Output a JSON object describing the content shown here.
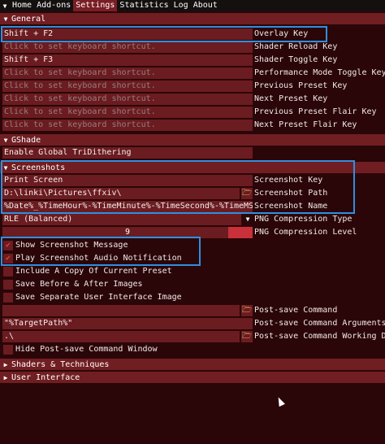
{
  "menubar": {
    "items": [
      "Home",
      "Add-ons",
      "Settings",
      "Statistics",
      "Log",
      "About"
    ],
    "active": "Settings"
  },
  "sections": {
    "general": "General",
    "gshade": "GShade",
    "screenshots": "Screenshots",
    "shaders": "Shaders & Techniques",
    "ui": "User Interface"
  },
  "general": {
    "rows": [
      {
        "value": "Shift + F2",
        "label": "Overlay Key"
      },
      {
        "value": "Click to set keyboard shortcut.",
        "label": "Shader Reload Key"
      },
      {
        "value": "Shift + F3",
        "label": "Shader Toggle Key"
      },
      {
        "value": "Click to set keyboard shortcut.",
        "label": "Performance Mode Toggle Key"
      },
      {
        "value": "Click to set keyboard shortcut.",
        "label": "Previous Preset Key"
      },
      {
        "value": "Click to set keyboard shortcut.",
        "label": "Next Preset Key"
      },
      {
        "value": "Click to set keyboard shortcut.",
        "label": "Previous Preset Flair Key"
      },
      {
        "value": "Click to set keyboard shortcut.",
        "label": "Next Preset Flair Key"
      }
    ]
  },
  "gshade": {
    "tridither_label": "Enable Global TriDithering"
  },
  "screenshots": {
    "key_value": "Print Screen",
    "key_label": "Screenshot Key",
    "path_value": "D:\\linki\\Pictures\\ffxiv\\",
    "path_label": "Screenshot Path",
    "name_value": "%Date%_%TimeHour%-%TimeMinute%-%TimeSecond%-%TimeMS%_%Pre",
    "name_label": "Screenshot Name",
    "compression_type_value": "RLE (Balanced)",
    "compression_type_label": "PNG Compression Type",
    "compression_level_value": "9",
    "compression_level_label": "PNG Compression Level",
    "show_message_label": "Show Screenshot Message",
    "audio_label": "Play Screenshot Audio Notification",
    "include_preset_label": "Include A Copy Of Current Preset",
    "save_before_after_label": "Save Before & After Images",
    "save_ui_label": "Save Separate User Interface Image",
    "post_save_command_value": "",
    "post_save_command_label": "Post-save Command",
    "post_save_args_value": "\"%TargetPath%\"",
    "post_save_args_label": "Post-save Command Arguments",
    "post_save_dir_value": ".\\",
    "post_save_dir_label": "Post-save Command Working Dir",
    "hide_window_label": "Hide Post-save Command Window"
  },
  "colors": {
    "accent_highlight": "#2f8fe0",
    "check_mark": "#e33a3a"
  }
}
